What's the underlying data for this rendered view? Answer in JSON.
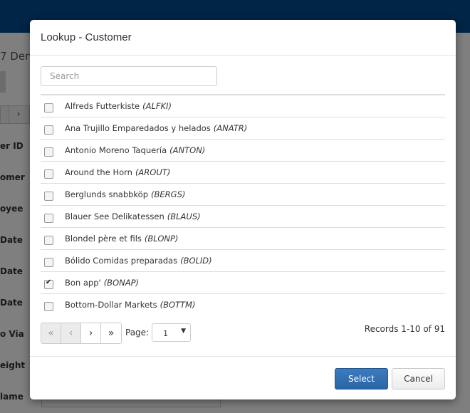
{
  "background": {
    "title_fragment": "7 Den",
    "tab_next_glyph": "›",
    "labels": [
      "er ID",
      "omer",
      "oyee",
      "Date",
      "Date",
      "Date",
      "o Via",
      "eight",
      "lame"
    ]
  },
  "modal": {
    "title": "Lookup - Customer",
    "search": {
      "placeholder": "Search",
      "value": ""
    },
    "rows": [
      {
        "name": "Alfreds Futterkiste",
        "code": "(ALFKI)",
        "checked": false
      },
      {
        "name": "Ana Trujillo Emparedados y helados",
        "code": "(ANATR)",
        "checked": false
      },
      {
        "name": "Antonio Moreno Taquería",
        "code": "(ANTON)",
        "checked": false
      },
      {
        "name": "Around the Horn",
        "code": "(AROUT)",
        "checked": false
      },
      {
        "name": "Berglunds snabbköp",
        "code": "(BERGS)",
        "checked": false
      },
      {
        "name": "Blauer See Delikatessen",
        "code": "(BLAUS)",
        "checked": false
      },
      {
        "name": "Blondel père et fils",
        "code": "(BLONP)",
        "checked": false
      },
      {
        "name": "Bólido Comidas preparadas",
        "code": "(BOLID)",
        "checked": false
      },
      {
        "name": "Bon app'",
        "code": "(BONAP)",
        "checked": true
      },
      {
        "name": "Bottom-Dollar Markets",
        "code": "(BOTTM)",
        "checked": false
      }
    ],
    "pager": {
      "first_glyph": "«",
      "prev_glyph": "‹",
      "next_glyph": "›",
      "last_glyph": "»",
      "page_label": "Page:",
      "page_value": "1",
      "records_text": "Records 1-10 of 91"
    },
    "footer": {
      "select_label": "Select",
      "cancel_label": "Cancel"
    }
  }
}
